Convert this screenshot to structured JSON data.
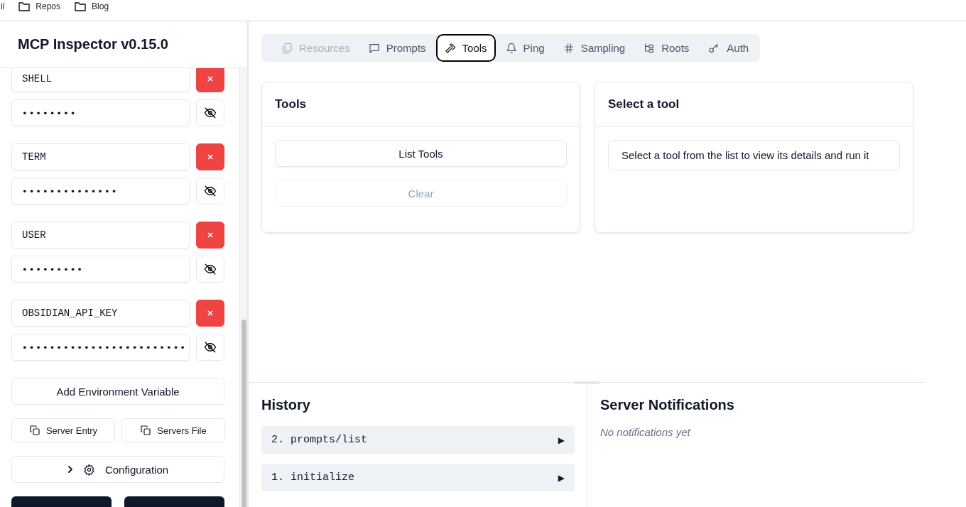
{
  "bookmarks": [
    {
      "label": "il",
      "kind": "cut"
    },
    {
      "label": "Repos",
      "kind": "folder"
    },
    {
      "label": "Blog",
      "kind": "folder"
    }
  ],
  "sidebar": {
    "title": "MCP Inspector v0.15.0",
    "env_vars": [
      {
        "key": "SHELL",
        "value": "••••••••"
      },
      {
        "key": "TERM",
        "value": "••••••••••••••"
      },
      {
        "key": "USER",
        "value": "•••••••••"
      },
      {
        "key": "OBSIDIAN_API_KEY",
        "value": "••••••••••••••••••••••••"
      }
    ],
    "add_button": "Add Environment Variable",
    "copy_buttons": [
      "Server Entry",
      "Servers File"
    ],
    "config_button": {
      "label": "Configuration",
      "expanded": false
    }
  },
  "tabs": [
    {
      "label": "Resources",
      "kind": "files",
      "disabled": true,
      "selected": false
    },
    {
      "label": "Prompts",
      "kind": "message",
      "disabled": false,
      "selected": false
    },
    {
      "label": "Tools",
      "kind": "hammer",
      "disabled": false,
      "selected": true
    },
    {
      "label": "Ping",
      "kind": "bell",
      "disabled": false,
      "selected": false
    },
    {
      "label": "Sampling",
      "kind": "hash",
      "disabled": false,
      "selected": false
    },
    {
      "label": "Roots",
      "kind": "tree",
      "disabled": false,
      "selected": false
    },
    {
      "label": "Auth",
      "kind": "key",
      "disabled": false,
      "selected": false
    }
  ],
  "tools_panel": {
    "title": "Tools",
    "buttons": [
      {
        "label": "List Tools",
        "disabled": false
      },
      {
        "label": "Clear",
        "disabled": true
      }
    ]
  },
  "detail_panel": {
    "title": "Select a tool",
    "message": "Select a tool from the list to view its details and run it"
  },
  "history": {
    "title": "History",
    "items": [
      {
        "label": "2. prompts/list",
        "toggle": "▶"
      },
      {
        "label": "1. initialize",
        "toggle": "▶"
      }
    ]
  },
  "notifications": {
    "title": "Server Notifications",
    "empty_text": "No notifications yet"
  }
}
